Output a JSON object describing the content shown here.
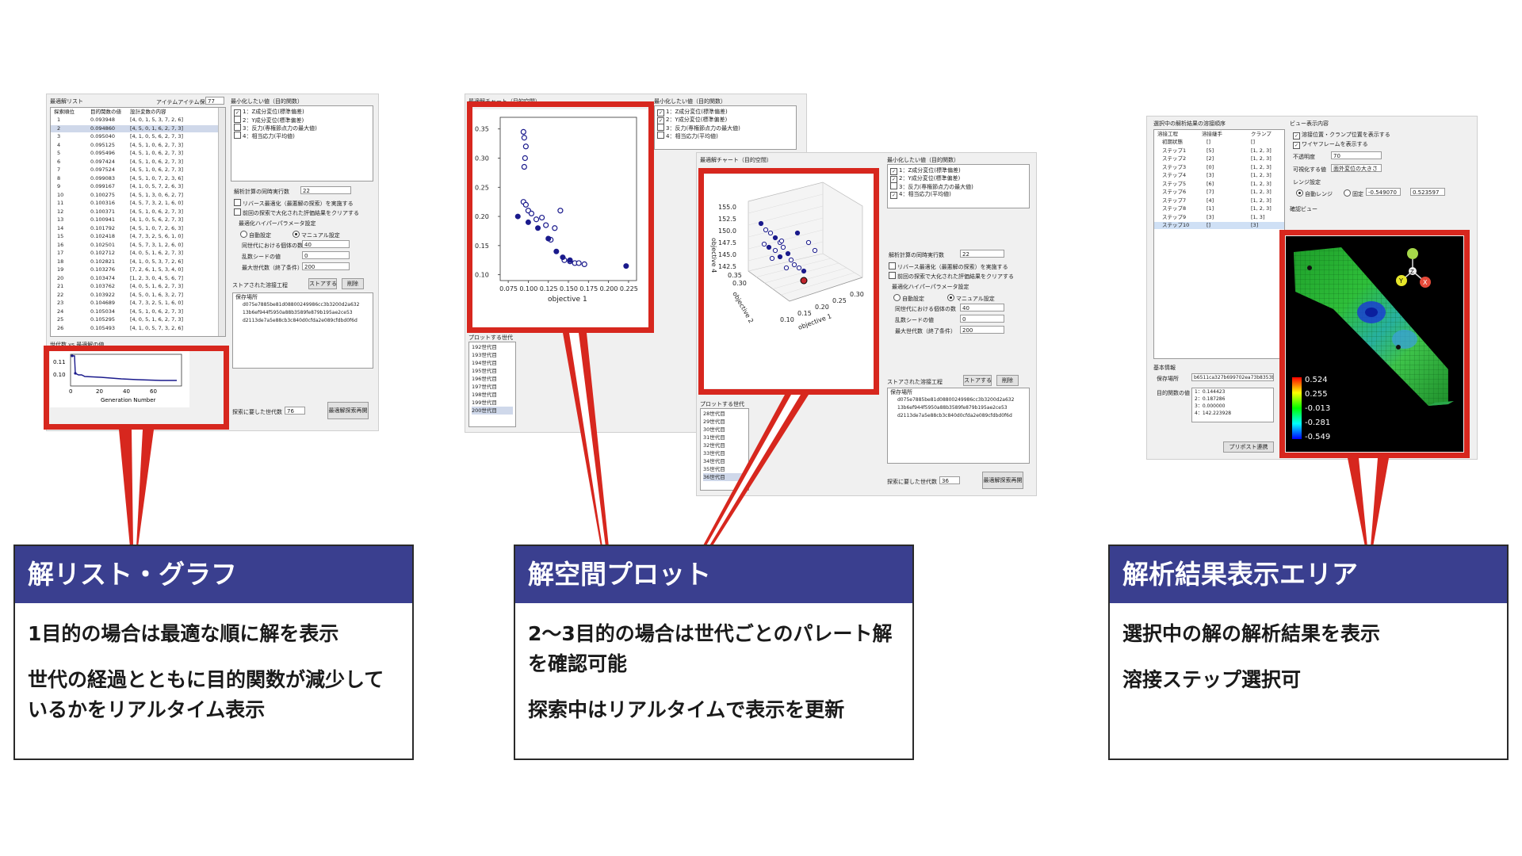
{
  "screenshot1": {
    "list_title": "最適解リスト",
    "keep_label": "アイテムアイテム保持数",
    "keep_value": "77",
    "columns": [
      "探索順位",
      "目的関数の値",
      "設計変数の内容"
    ],
    "rows": [
      [
        "1",
        "0.093948",
        "[4, 0, 1, 5, 3, 7, 2, 6]"
      ],
      [
        "2",
        "0.094860",
        "[4, 5, 0, 1, 6, 2, 7, 3]"
      ],
      [
        "3",
        "0.095040",
        "[4, 1, 0, 5, 6, 2, 7, 3]"
      ],
      [
        "4",
        "0.095125",
        "[4, 5, 1, 0, 6, 2, 7, 3]"
      ],
      [
        "5",
        "0.095496",
        "[4, 5, 1, 0, 6, 2, 7, 3]"
      ],
      [
        "6",
        "0.097424",
        "[4, 5, 1, 0, 6, 2, 7, 3]"
      ],
      [
        "7",
        "0.097524",
        "[4, 5, 1, 0, 6, 2, 7, 3]"
      ],
      [
        "8",
        "0.099083",
        "[4, 5, 1, 0, 7, 2, 3, 6]"
      ],
      [
        "9",
        "0.099167",
        "[4, 1, 0, 5, 7, 2, 6, 3]"
      ],
      [
        "10",
        "0.100275",
        "[4, 5, 1, 3, 0, 6, 2, 7]"
      ],
      [
        "11",
        "0.100316",
        "[4, 5, 7, 3, 2, 1, 6, 0]"
      ],
      [
        "12",
        "0.100371",
        "[4, 5, 1, 0, 6, 2, 7, 3]"
      ],
      [
        "13",
        "0.100941",
        "[4, 1, 0, 5, 6, 2, 7, 3]"
      ],
      [
        "14",
        "0.101792",
        "[4, 5, 1, 0, 7, 2, 6, 3]"
      ],
      [
        "15",
        "0.102418",
        "[4, 7, 3, 2, 5, 6, 1, 0]"
      ],
      [
        "16",
        "0.102501",
        "[4, 5, 7, 3, 1, 2, 6, 0]"
      ],
      [
        "17",
        "0.102712",
        "[4, 0, 5, 1, 6, 2, 7, 3]"
      ],
      [
        "18",
        "0.102821",
        "[4, 1, 0, 5, 3, 7, 2, 6]"
      ],
      [
        "19",
        "0.103276",
        "[7, 2, 6, 1, 5, 3, 4, 0]"
      ],
      [
        "20",
        "0.103474",
        "[1, 2, 3, 0, 4, 5, 6, 7]"
      ],
      [
        "21",
        "0.103762",
        "[4, 0, 5, 1, 6, 2, 7, 3]"
      ],
      [
        "22",
        "0.103922",
        "[4, 5, 0, 1, 6, 3, 2, 7]"
      ],
      [
        "23",
        "0.104689",
        "[4, 7, 3, 2, 5, 1, 6, 0]"
      ],
      [
        "24",
        "0.105034",
        "[4, 5, 1, 0, 6, 2, 7, 3]"
      ],
      [
        "25",
        "0.105295",
        "[4, 0, 5, 1, 6, 2, 7, 3]"
      ],
      [
        "26",
        "0.105493",
        "[4, 1, 0, 5, 7, 3, 2, 6]"
      ]
    ],
    "objectives_title": "最小化したい値（目的関数）",
    "objectives": [
      {
        "label": "1：Z成分変位(標準偏差)",
        "checked": "✓"
      },
      {
        "label": "2：Y成分変位(標準偏差)",
        "checked": ""
      },
      {
        "label": "3：反力(専権節点力の最大値)",
        "checked": ""
      },
      {
        "label": "4：相当応力(平均値)",
        "checked": ""
      }
    ],
    "parallel_label": "解析計算の同時実行数",
    "parallel_value": "22",
    "surrogate_label": "リバース最適化（最悪解の探索）を実施する",
    "clear_label": "前回の探索で大化された評価結果をクリアする",
    "hyper_label": "最適化ハイパーパラメータ設定",
    "auto_label": "自動設定",
    "manual_label": "マニュアル設定",
    "pop_label": "同世代における個体の数",
    "pop_value": "40",
    "seed_label": "乱数シードの値",
    "seed_value": "0",
    "maxgen_label": "最大世代数（終了条件）",
    "maxgen_value": "200",
    "stored_label": "ストアされた溶接工程",
    "store_btn": "ストアする",
    "delete_btn": "削除",
    "save_loc_label": "保存場所",
    "paths": [
      "d075e7885be81d08800249986cc3b3200d2a632",
      "13b6ef944f5950a88b3589fe879b195ae2ce53",
      "d2113de7a5e88cb3c840d0cfda2e089cfdbd0f6d"
    ],
    "graph_title": "世代数 vs 最適解の値",
    "graph_x_label": "Generation Number",
    "graph_yticks": [
      "0.11",
      "0.10"
    ],
    "graph_xticks": [
      "0",
      "20",
      "40",
      "60"
    ],
    "searched_label": "探索に要した世代数",
    "searched_value": "76",
    "best_btn": "最適解探索再開"
  },
  "screenshot2": {
    "chart_title": "最適解チャート（目的空間）",
    "plot_gen_label": "プロットする世代",
    "gens": [
      "192世代目",
      "193世代目",
      "194世代目",
      "195世代目",
      "196世代目",
      "197世代目",
      "198世代目",
      "199世代目",
      "200世代目"
    ],
    "objectives_title": "最小化したい値（目的関数）",
    "objectives": [
      {
        "label": "1：Z成分変位(標準偏差)",
        "checked": "✓"
      },
      {
        "label": "2：Y成分変位(標準偏差)",
        "checked": "✓"
      },
      {
        "label": "3：反力(専権節点力の最大値)",
        "checked": ""
      },
      {
        "label": "4：相当応力(平均値)",
        "checked": ""
      }
    ],
    "chart_data": {
      "type": "scatter",
      "xlabel": "objective 1",
      "ylabel": "",
      "x_ticks": [
        "0.075",
        "0.100",
        "0.125",
        "0.150",
        "0.175",
        "0.200",
        "0.225"
      ],
      "y_ticks": [
        "0.35",
        "0.30",
        "0.25",
        "0.20",
        "0.15",
        "0.10"
      ],
      "xlim": [
        0.065,
        0.235
      ],
      "ylim": [
        0.09,
        0.37
      ],
      "series": [
        {
          "points": [
            [
              0.094,
              0.345
            ],
            [
              0.095,
              0.335
            ],
            [
              0.097,
              0.32
            ],
            [
              0.096,
              0.3
            ],
            [
              0.095,
              0.285
            ],
            [
              0.094,
              0.225
            ],
            [
              0.097,
              0.22
            ],
            [
              0.1,
              0.21
            ],
            [
              0.104,
              0.205
            ],
            [
              0.11,
              0.195
            ],
            [
              0.117,
              0.198
            ],
            [
              0.122,
              0.185
            ],
            [
              0.128,
              0.16
            ],
            [
              0.133,
              0.18
            ],
            [
              0.14,
              0.21
            ],
            [
              0.145,
              0.125
            ],
            [
              0.152,
              0.123
            ],
            [
              0.158,
              0.12
            ],
            [
              0.163,
              0.12
            ],
            [
              0.17,
              0.118
            ]
          ]
        },
        {
          "points": [
            [
              0.087,
              0.2
            ],
            [
              0.1,
              0.19
            ],
            [
              0.112,
              0.18
            ],
            [
              0.125,
              0.162
            ],
            [
              0.135,
              0.14
            ],
            [
              0.143,
              0.13
            ],
            [
              0.152,
              0.125
            ],
            [
              0.222,
              0.115
            ]
          ]
        }
      ]
    },
    "chart3d": {
      "zlabel": "objective 4",
      "xlabel": "objective 1",
      "ylabel": "objective 2",
      "z_ticks": [
        "155.0",
        "152.5",
        "150.0",
        "147.5",
        "145.0",
        "142.5"
      ],
      "x_ticks": [
        "0.10",
        "0.15",
        "0.20",
        "0.25",
        "0.30"
      ],
      "y_ticks": [
        "0.35",
        "0.30",
        "0.25",
        "0.20",
        "0.15",
        "0.10"
      ]
    },
    "objectives_b": [
      {
        "label": "1：Z成分変位(標準偏差)",
        "checked": "✓"
      },
      {
        "label": "2：Y成分変位(標準偏差)",
        "checked": "✓"
      },
      {
        "label": "3：反力(専権節点力の最大値)",
        "checked": ""
      },
      {
        "label": "4：相当応力(平均値)",
        "checked": "✓"
      }
    ],
    "gens_b": [
      "28世代目",
      "29世代目",
      "30世代目",
      "31世代目",
      "32世代目",
      "33世代目",
      "34世代目",
      "35世代目",
      "36世代目"
    ],
    "searched_value": "36"
  },
  "screenshot3": {
    "order_title": "選択中の解析結果の溶接順序",
    "columns": [
      "溶接工程",
      "溶接継手",
      "クランプ"
    ],
    "steps": [
      [
        "初期状態",
        "[]",
        "[]"
      ],
      [
        "ステップ1",
        "[5]",
        "[1, 2, 3]"
      ],
      [
        "ステップ2",
        "[2]",
        "[1, 2, 3]"
      ],
      [
        "ステップ3",
        "[0]",
        "[1, 2, 3]"
      ],
      [
        "ステップ4",
        "[3]",
        "[1, 2, 3]"
      ],
      [
        "ステップ5",
        "[6]",
        "[1, 2, 3]"
      ],
      [
        "ステップ6",
        "[7]",
        "[1, 2, 3]"
      ],
      [
        "ステップ7",
        "[4]",
        "[1, 2, 3]"
      ],
      [
        "ステップ8",
        "[1]",
        "[1, 2, 3]"
      ],
      [
        "ステップ9",
        "[3]",
        "[1, 3]"
      ],
      [
        "ステップ10",
        "[]",
        "[3]"
      ]
    ],
    "view_title": "ビュー表示内容",
    "view_opt1": "溶接位置・クランプ位置を表示する",
    "view_opt2": "ワイヤフレームを表示する",
    "opacity_label": "不透明度",
    "opacity_value": "70",
    "visual_label": "可視化する値",
    "visual_value": "面外変位の大きさ",
    "range_label": "レンジ設定",
    "auto_range": "自動レンジ",
    "fixed_range": "固定",
    "range_min": "-0.549070",
    "range_max": "0.523597",
    "view_label": "確認ビュー",
    "basic_info": "基本情報",
    "save_loc_label": "保存場所",
    "save_loc_value": "b6511ca327b699702ea73b8353b",
    "obj_label": "目的関数の値",
    "obj_values": [
      "1：0.144423",
      "2：0.187286",
      "3：0.000000",
      "4：142.223928"
    ],
    "post_btn": "プリポスト連携",
    "colorbar_ticks": [
      "0.524",
      "0.255",
      "-0.013",
      "-0.281",
      "-0.549"
    ],
    "axis_y": "Y",
    "axis_z": "Z",
    "axis_x": "X"
  },
  "cards": [
    {
      "title": "解リスト・グラフ",
      "lines": [
        "1目的の場合は最適な順に解を表示",
        "世代の経過とともに目的関数が減少しているかをリアルタイム表示"
      ]
    },
    {
      "title": "解空間プロット",
      "lines": [
        "2～3目的の場合は世代ごとのパレート解を確認可能",
        "探索中はリアルタイムで表示を更新"
      ]
    },
    {
      "title": "解析結果表示エリア",
      "lines": [
        "選択中の解の解析結果を表示",
        "溶接ステップ選択可"
      ]
    }
  ],
  "colors": {
    "accent_red": "#d7271e",
    "card_header": "#3a3f8f"
  }
}
